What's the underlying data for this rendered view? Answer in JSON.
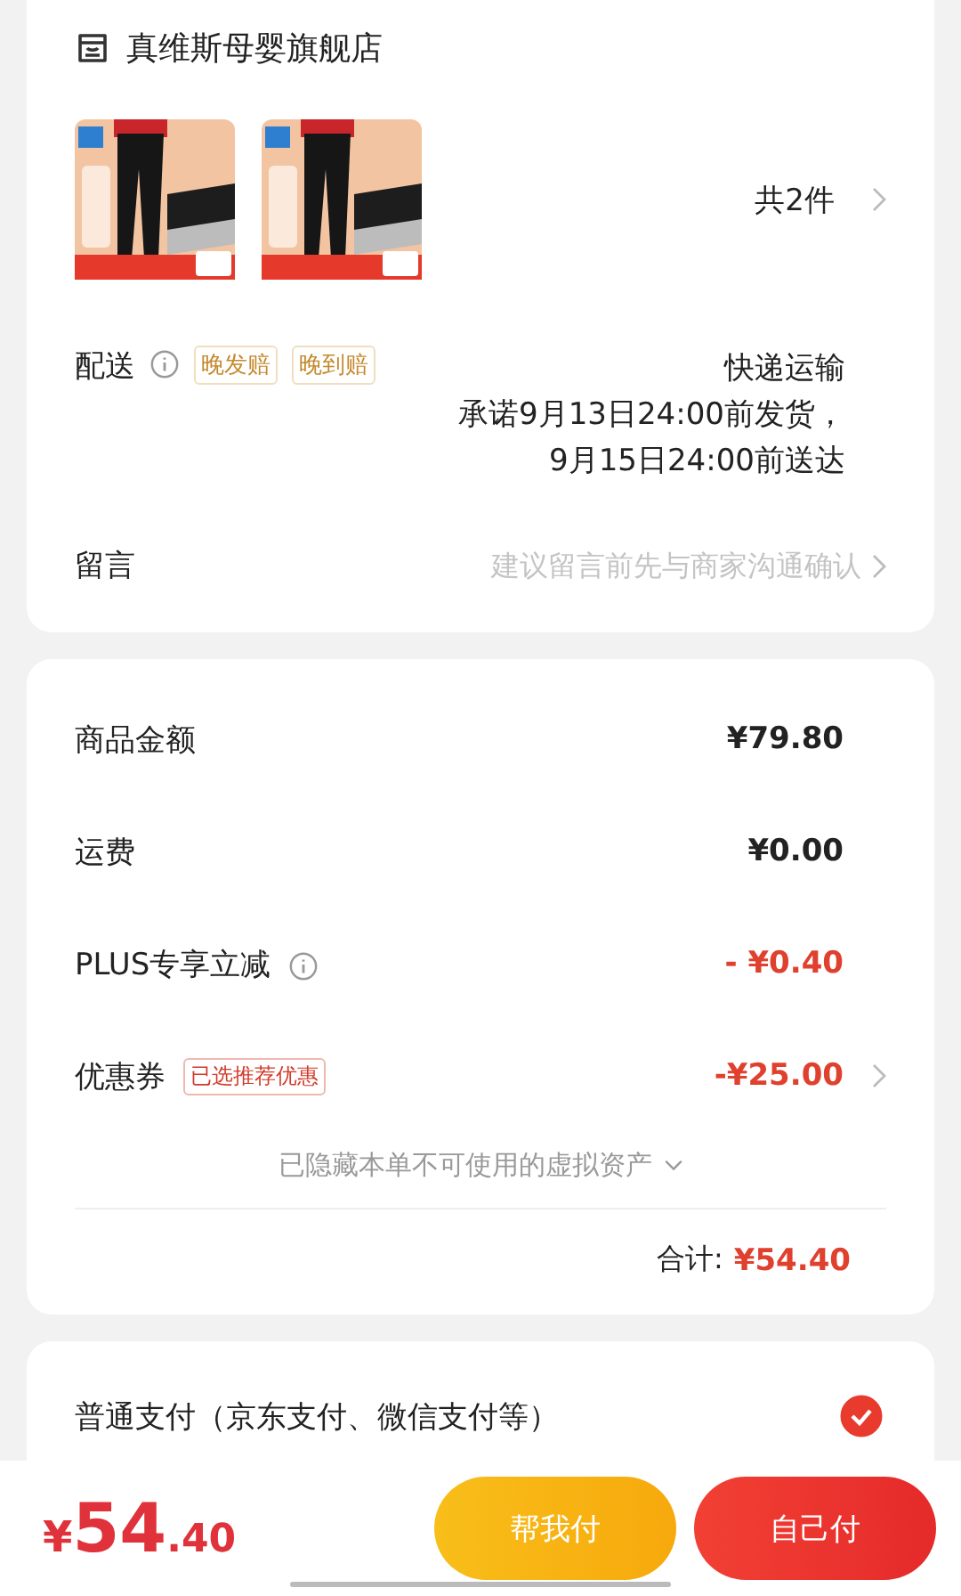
{
  "shop": {
    "name": "真维斯母婴旗舰店"
  },
  "products": {
    "count": "共2件"
  },
  "delivery": {
    "label": "配送",
    "tags": [
      "晚发赔",
      "晚到赔"
    ],
    "method": "快递运输",
    "promise": [
      "承诺9月13日24:00前发货，",
      "9月15日24:00前送达"
    ]
  },
  "message": {
    "label": "留言",
    "placeholder": "建议留言前先与商家沟通确认"
  },
  "price_rows": [
    {
      "label": "商品金额",
      "value": "¥79.80",
      "kind": "plain"
    },
    {
      "label": "运费",
      "value": "¥0.00",
      "kind": "plain"
    },
    {
      "label": "PLUS专享立减",
      "value": "- ¥0.40",
      "kind": "info"
    },
    {
      "label": "优惠券",
      "tag": "已选推荐优惠",
      "value": "-¥25.00",
      "kind": "coupon"
    }
  ],
  "hidden_assets": "已隐藏本单不可使用的虚拟资产",
  "total": {
    "label": "合计:",
    "value": "¥54.40"
  },
  "payment": [
    {
      "label": "普通支付（京东支付、微信支付等）",
      "selected": true
    }
  ],
  "bottom_bar": {
    "currency": "¥",
    "amount_int": "54",
    "amount_dec": ".40",
    "buttons": [
      {
        "label": "帮我付",
        "kind": "secondary"
      },
      {
        "label": "自己付",
        "kind": "primary"
      }
    ]
  }
}
